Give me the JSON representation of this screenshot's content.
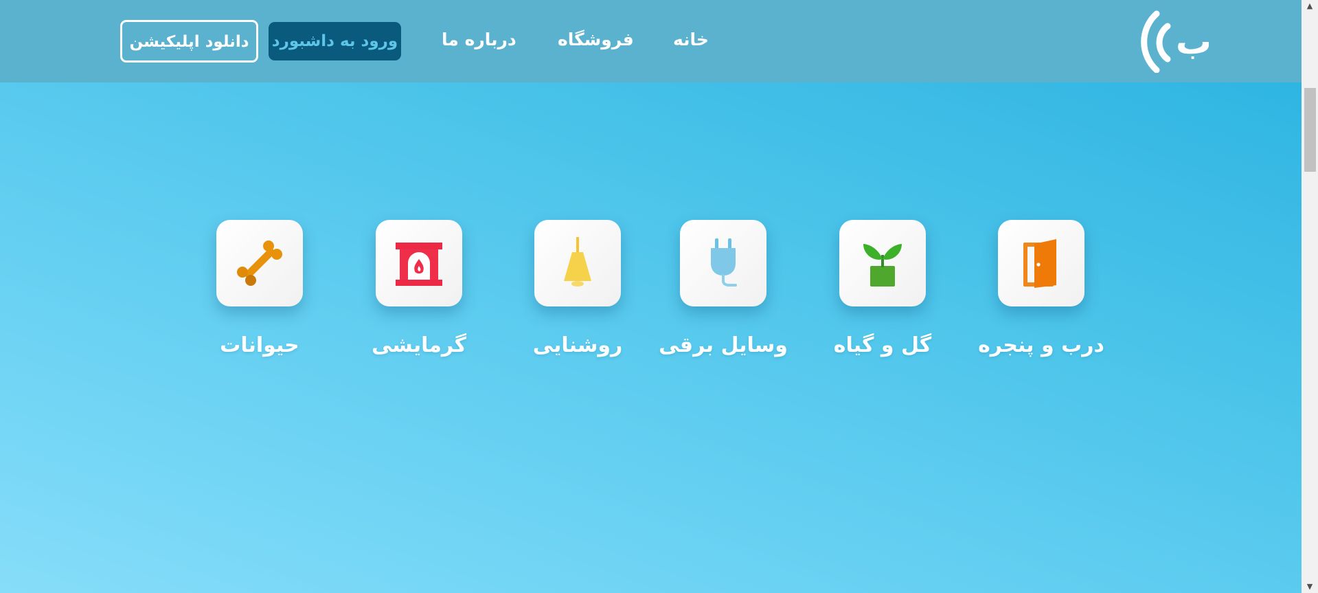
{
  "header": {
    "logo_letter": "ب",
    "nav": {
      "home": "خانه",
      "shop": "فروشگاه",
      "about": "درباره ما"
    },
    "dashboard_button": "ورود به داشبورد",
    "download_button": "دانلود اپلیکیشن"
  },
  "categories": [
    {
      "label": "درب و پنجره",
      "icon": "door-icon"
    },
    {
      "label": "گل و گیاه",
      "icon": "plant-icon"
    },
    {
      "label": "وسایل برقی",
      "icon": "plug-icon"
    },
    {
      "label": "روشنایی",
      "icon": "bell-lamp-icon"
    },
    {
      "label": "گرمایشی",
      "icon": "fireplace-icon"
    },
    {
      "label": "حیوانات",
      "icon": "bone-icon"
    }
  ],
  "colors": {
    "header_bg": "#5ab2cf",
    "page_gradient_start": "#27b1e0",
    "page_gradient_end": "#86ddf9",
    "dashboard_button_bg": "#0a5a7e",
    "dashboard_button_text": "#5fc5e8"
  }
}
